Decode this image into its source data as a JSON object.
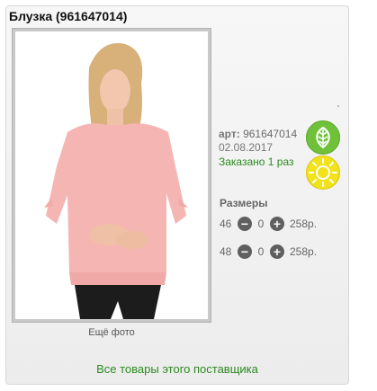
{
  "product": {
    "title": "Блузка (961647014)",
    "more_photo_label": "Ещё фото",
    "art_label": "арт:",
    "art_value": "961647014",
    "date": "02.08.2017",
    "ordered_text": "Заказано 1 раз",
    "marker": "'"
  },
  "badges": {
    "leaf_icon": "leaf-icon",
    "sun_icon": "sun-icon",
    "leaf_color": "#6fc13a",
    "sun_color": "#f1e21a"
  },
  "sizes": {
    "title": "Размеры",
    "rows": [
      {
        "size": "46",
        "qty": "0",
        "price": "258р."
      },
      {
        "size": "48",
        "qty": "0",
        "price": "258р."
      }
    ]
  },
  "footer": {
    "all_goods_link": "Все товары этого поставщика"
  }
}
